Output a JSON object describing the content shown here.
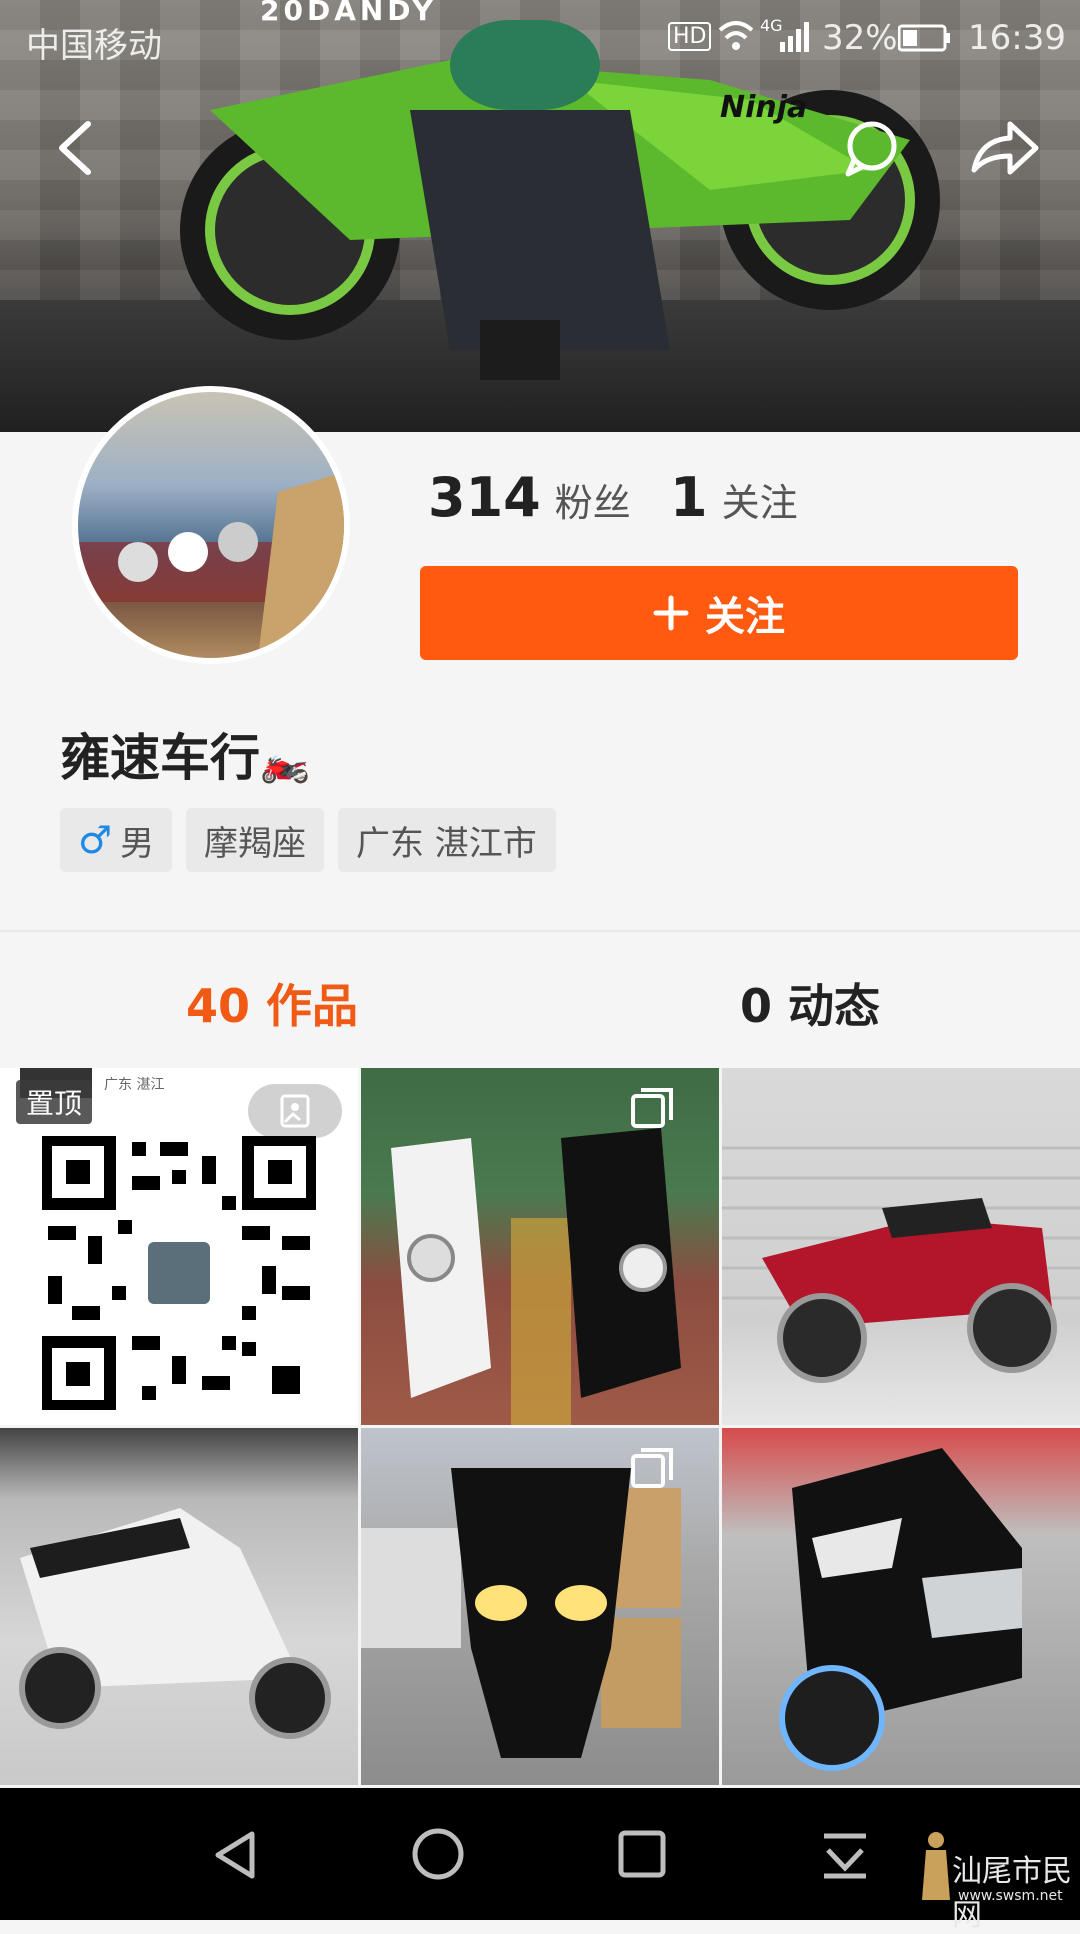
{
  "status_bar": {
    "carrier": "中国移动",
    "network": "HD",
    "signal": "4G",
    "battery": "32%",
    "time": "16:39"
  },
  "cover": {
    "brand_text": "20DANDY",
    "bike_text": "Ninja"
  },
  "header": {
    "back_icon": "chevron-left-icon",
    "message_icon": "chat-bubble-icon",
    "share_icon": "share-arrow-icon"
  },
  "profile": {
    "followers_count": "314",
    "followers_label": "粉丝",
    "following_count": "1",
    "following_label": "关注",
    "follow_button": "关注",
    "username": "雍速车行",
    "username_emoji": "🏍️",
    "gender_symbol": "♂",
    "gender": "男",
    "zodiac": "摩羯座",
    "location": "广东 湛江市"
  },
  "tabs": [
    {
      "count": "40",
      "label": "作品",
      "active": true
    },
    {
      "count": "0",
      "label": "动态",
      "active": false
    }
  ],
  "grid": {
    "pinned_label": "置顶",
    "first_caption": "广东 湛江"
  },
  "nav": {
    "back": "triangle-back-icon",
    "home": "circle-home-icon",
    "recent": "square-recent-icon",
    "down": "notification-down-icon"
  },
  "watermark": {
    "text": "汕尾市民网",
    "url": "www.swsm.net"
  },
  "colors": {
    "accent": "#ff5a10",
    "tab_active": "#f05a14",
    "tab_inactive": "#222222"
  }
}
